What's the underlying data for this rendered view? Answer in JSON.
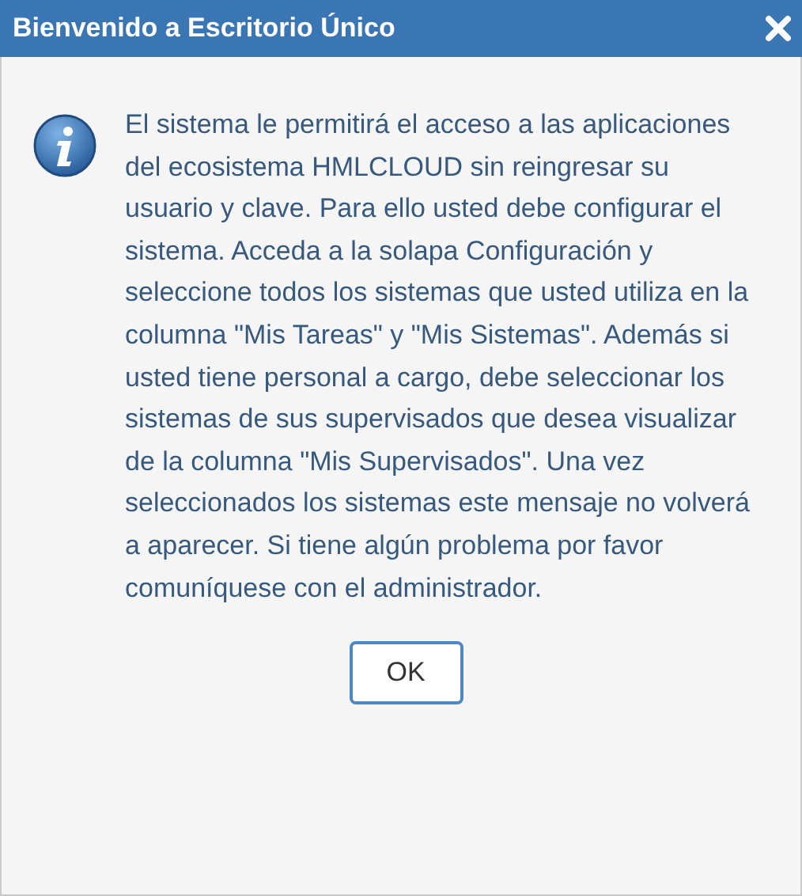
{
  "dialog": {
    "title": "Bienvenido a Escritorio Único",
    "message": "El sistema le permitirá el acceso a las aplicaciones del ecosistema HMLCLOUD sin reingresar su usuario y clave. Para ello usted debe configurar el sistema. Acceda a la solapa Configuración y seleccione todos los sistemas que usted utiliza en la columna \"Mis Tareas\" y \"Mis Sistemas\". Además si usted tiene personal a cargo, debe seleccionar los sistemas de sus supervisados que desea visualizar de la columna \"Mis Supervisados\". Una vez seleccionados los sistemas este mensaje no volverá a aparecer. Si tiene algún problema por favor comuníquese con el administrador.",
    "buttons": [
      "OK"
    ]
  }
}
